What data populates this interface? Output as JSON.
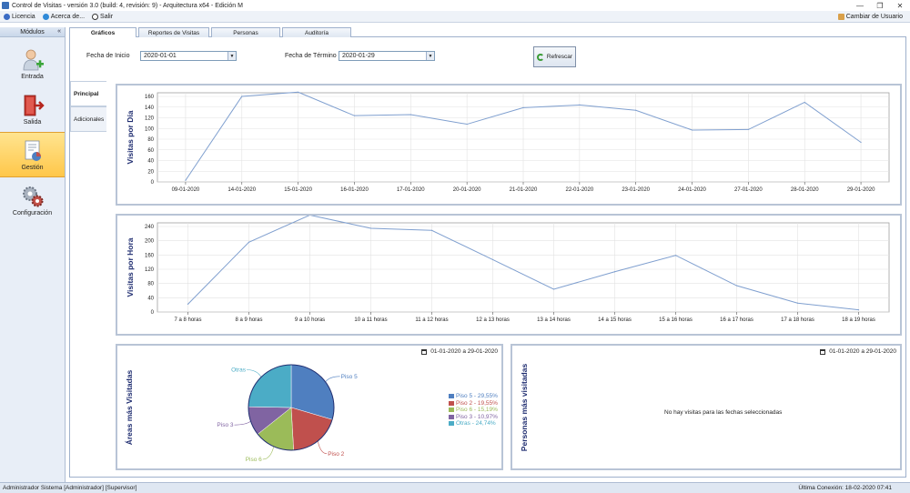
{
  "window": {
    "title": "Control de Visitas - versión 3.0 (build: 4, revisión: 9) - Arquitectura x64 - Edición M",
    "minimize": "—",
    "restore": "❐",
    "close": "✕"
  },
  "menu": {
    "items": [
      {
        "label": "Licencia",
        "icon": "license-icon",
        "color": "#3b6cc4"
      },
      {
        "label": "Acerca de...",
        "icon": "info-icon",
        "color": "#2f8ad8"
      },
      {
        "label": "Salir",
        "icon": "power-icon",
        "color": "#333333"
      }
    ],
    "change_user": "Cambiar de Usuario"
  },
  "sidebar": {
    "header": "Módulos",
    "collapse": "«",
    "modules": [
      {
        "label": "Entrada",
        "icon": "user-add-icon"
      },
      {
        "label": "Salida",
        "icon": "exit-door-icon"
      },
      {
        "label": "Gestión",
        "icon": "document-chart-icon",
        "active": true
      },
      {
        "label": "Configuración",
        "icon": "gears-icon"
      }
    ]
  },
  "tabs": [
    {
      "label": "Gráficos",
      "active": true
    },
    {
      "label": "Reportes de Visitas"
    },
    {
      "label": "Personas"
    },
    {
      "label": "Auditoría"
    }
  ],
  "filters": {
    "start_label": "Fecha de Inicio",
    "start_value": "2020-01-01",
    "end_label": "Fecha de Término",
    "end_value": "2020-01-29",
    "refresh": "Refrescar"
  },
  "vertical_tabs": [
    {
      "label": "Principal",
      "active": true
    },
    {
      "label": "Adicionales"
    }
  ],
  "pie_panel": {
    "title": "Áreas más Visitadas",
    "range": "01-01-2020 a 29-01-2020"
  },
  "people_panel": {
    "title": "Personas más visitadas",
    "range": "01-01-2020 a 29-01-2020",
    "empty": "No hay visitas para las fechas seleccionadas"
  },
  "status": {
    "user": "Administrador Sistema [Administrador] [Supervisor]",
    "last_login": "Última Conexión: 18-02-2020 07:41"
  },
  "chart_data": [
    {
      "type": "line",
      "ylabel": "Visitas por Día",
      "x": [
        "09-01-2020",
        "14-01-2020",
        "15-01-2020",
        "16-01-2020",
        "17-01-2020",
        "20-01-2020",
        "21-01-2020",
        "22-01-2020",
        "23-01-2020",
        "24-01-2020",
        "27-01-2020",
        "28-01-2020",
        "29-01-2020"
      ],
      "values": [
        3,
        160,
        168,
        124,
        126,
        108,
        139,
        144,
        134,
        97,
        98,
        149,
        74
      ],
      "yticks": [
        0,
        20,
        40,
        60,
        80,
        100,
        120,
        140,
        160
      ],
      "ylim": [
        0,
        160
      ],
      "grid": true,
      "color": "#7f9fcf"
    },
    {
      "type": "line",
      "ylabel": "Visitas por Hora",
      "x": [
        "7 a 8 horas",
        "8 a 9 horas",
        "9 a 10 horas",
        "10 a 11 horas",
        "11 a 12 horas",
        "12 a 13 horas",
        "13 a 14 horas",
        "14 a 15 horas",
        "15 a 16 horas",
        "16 a 17 horas",
        "17 a 18 horas",
        "18 a 19 horas"
      ],
      "values": [
        22,
        196,
        272,
        235,
        229,
        147,
        64,
        113,
        159,
        74,
        25,
        6
      ],
      "yticks": [
        0,
        40,
        80,
        120,
        160,
        200,
        240
      ],
      "ylim": [
        0,
        240
      ],
      "grid": true,
      "color": "#7f9fcf"
    },
    {
      "type": "pie",
      "slices": [
        {
          "name": "Piso 5",
          "value": 29.55,
          "color": "#4f7fc0",
          "legend": "Piso 5 - 29,55%"
        },
        {
          "name": "Piso 2",
          "value": 19.55,
          "color": "#c0504d",
          "legend": "Piso 2 - 19,55%"
        },
        {
          "name": "Piso 6",
          "value": 15.19,
          "color": "#9bbb59",
          "legend": "Piso 6 - 15,19%"
        },
        {
          "name": "Piso 3",
          "value": 10.97,
          "color": "#8064a2",
          "legend": "Piso 3 - 10,97%"
        },
        {
          "name": "Otras",
          "value": 24.74,
          "color": "#4bacc6",
          "legend": "Otras - 24,74%"
        }
      ]
    }
  ]
}
